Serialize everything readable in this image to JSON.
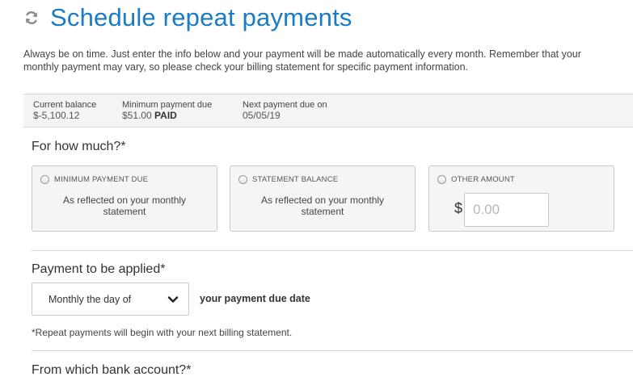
{
  "header": {
    "icon": "refresh-icon",
    "title": "Schedule repeat payments"
  },
  "intro": {
    "line1": "Always be on time. Just enter the info below and your payment will be made automatically every month. Remember that your",
    "line2": "monthly payment may vary, so please check your billing statement for specific payment information."
  },
  "summary": {
    "current_balance_label": "Current balance",
    "current_balance_value": "$-5,100.12",
    "min_payment_label": "Minimum payment due",
    "min_payment_value": "$51.00",
    "min_payment_status": "PAID",
    "next_due_label": "Next payment due on",
    "next_due_value": "05/05/19"
  },
  "amount_section": {
    "heading": "For how much?*",
    "options": [
      {
        "label": "MINIMUM PAYMENT DUE",
        "desc_line1": "As reflected on your monthly",
        "desc_line2": "statement",
        "selected": false
      },
      {
        "label": "STATEMENT BALANCE",
        "desc_line1": "As reflected on your monthly",
        "desc_line2": "statement",
        "selected": false
      },
      {
        "label": "OTHER AMOUNT",
        "currency_symbol": "$",
        "placeholder": "0.00",
        "value": "",
        "selected": false
      }
    ]
  },
  "apply_section": {
    "heading": "Payment to be applied*",
    "select_value": "Monthly the day of",
    "suffix": "your payment due date",
    "footnote": "*Repeat payments will begin with your next billing statement."
  },
  "bank_section": {
    "heading": "From which bank account?*"
  },
  "colors": {
    "title_blue": "#1a7cc4",
    "card_bg": "#f5f5f5",
    "border": "#c9c9c9"
  }
}
